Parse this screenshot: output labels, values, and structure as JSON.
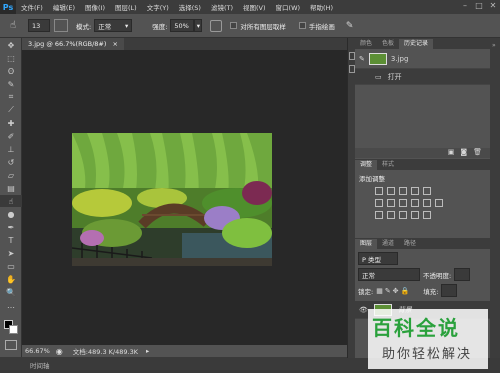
{
  "app": {
    "logo": "Ps"
  },
  "menu": [
    "文件(F)",
    "编辑(E)",
    "图像(I)",
    "图层(L)",
    "文字(Y)",
    "选择(S)",
    "滤镜(T)",
    "视图(V)",
    "窗口(W)",
    "帮助(H)"
  ],
  "options": {
    "brush_size": "13",
    "mode_label": "模式:",
    "mode_value": "正常",
    "strength_label": "强度:",
    "strength_value": "50%",
    "sample_all_label": "对所有图层取样",
    "finger_paint_label": "手指绘画"
  },
  "document": {
    "tab_title": "3.jpg @ 66.7%(RGB/8#)"
  },
  "status": {
    "zoom": "66.67%",
    "doc_size": "文档:489.3 K/489.3K"
  },
  "bottom": {
    "timeline": "时间轴"
  },
  "history_panel": {
    "tabs": [
      "颜色",
      "色板",
      "历史记录"
    ],
    "snapshot_name": "3.jpg",
    "step_open": "打开"
  },
  "adjust_panel": {
    "tabs": [
      "调整",
      "样式"
    ],
    "add_adjustment": "添加调整"
  },
  "layers_panel": {
    "tabs": [
      "图层",
      "通道",
      "路径"
    ],
    "kind_label": "P 类型",
    "blend_mode": "正常",
    "opacity_label": "不透明度:",
    "lock_label": "锁定:",
    "fill_label": "填充:",
    "layer_name": "背景"
  },
  "watermark": {
    "line1": "百科全说",
    "line2": "助你轻松解决"
  },
  "colors": {
    "accent": "#31a8ff",
    "watermark_green": "#2aa13c"
  }
}
